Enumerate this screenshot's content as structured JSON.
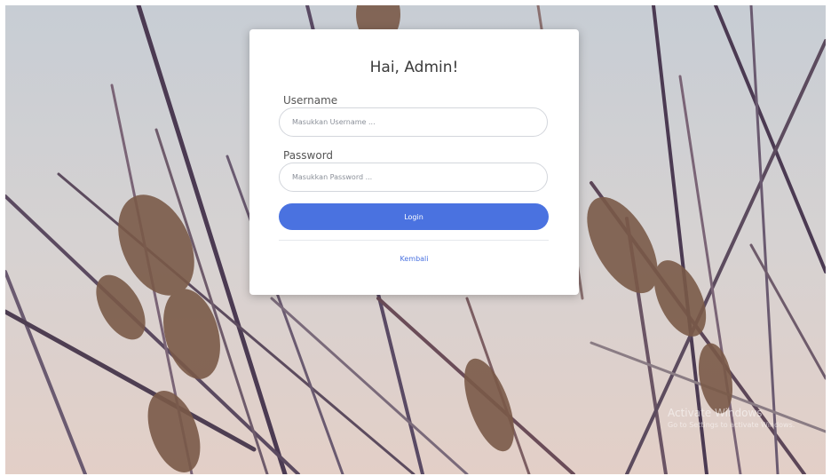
{
  "login": {
    "title": "Hai, Admin!",
    "username_label": "Username",
    "username_placeholder": "Masukkan Username ...",
    "password_label": "Password",
    "password_placeholder": "Masukkan Password ...",
    "login_button": "Login",
    "back_link": "Kembali"
  },
  "watermark": {
    "line1": "Activate Windows",
    "line2": "Go to Settings to activate Windows."
  },
  "colors": {
    "primary": "#4a72e0",
    "card_bg": "#ffffff"
  }
}
